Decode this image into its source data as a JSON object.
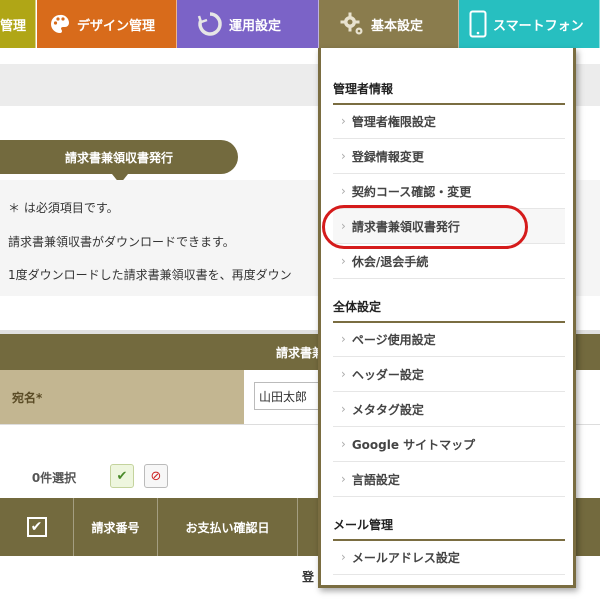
{
  "nav": {
    "tabs": [
      {
        "label": "管理",
        "icon": "none"
      },
      {
        "label": "デザイン管理",
        "icon": "palette-icon"
      },
      {
        "label": "運用設定",
        "icon": "refresh-icon"
      },
      {
        "label": "基本設定",
        "icon": "gear-icon"
      },
      {
        "label": "スマートフォン",
        "icon": "smartphone-icon"
      }
    ]
  },
  "page": {
    "section_title": "請求書兼領収書発行",
    "notes": [
      "＊ は必須項目です。",
      "請求書兼領収書がダウンロードできます。",
      "1度ダウンロードした請求書兼領収書を、再度ダウン"
    ]
  },
  "form": {
    "header": "請求書兼",
    "recipient_label": "宛名*",
    "recipient_value": "山田太郎"
  },
  "selection": {
    "count": "0件選択",
    "select_all_icon": "checkbox-check-icon",
    "deselect_icon": "clear-selection-icon"
  },
  "table": {
    "columns": [
      "請求番号",
      "お支払い確認日"
    ],
    "row_text": "登"
  },
  "dropdown": {
    "sections": [
      {
        "title": "管理者情報",
        "items": [
          "管理者権限設定",
          "登録情報変更",
          "契約コース確認・変更",
          "請求書兼領収書発行",
          "休会/退会手続"
        ]
      },
      {
        "title": "全体設定",
        "items": [
          "ページ使用設定",
          "ヘッダー設定",
          "メタタグ設定",
          "Google サイトマップ",
          "言語設定"
        ]
      },
      {
        "title": "メール管理",
        "items": [
          "メールアドレス設定"
        ]
      }
    ],
    "highlighted_item": "請求書兼領収書発行"
  },
  "colors": {
    "olive": "#736a3e",
    "highlight": "#d51b1b",
    "design_tab": "#d86b1b",
    "ops_tab": "#7b63c7",
    "sp_tab": "#27bfc0"
  }
}
